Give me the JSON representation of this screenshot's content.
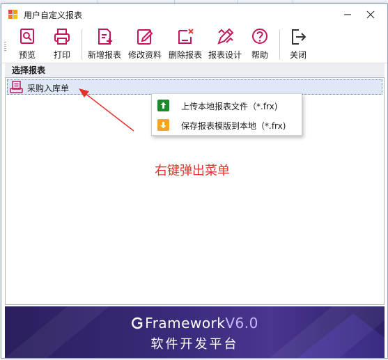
{
  "window": {
    "title": "用户自定义报表"
  },
  "toolbar": {
    "buttons": [
      {
        "label": "预览",
        "icon": "preview-icon"
      },
      {
        "label": "打印",
        "icon": "printer-icon"
      },
      {
        "label": "新增报表",
        "icon": "new-report-icon"
      },
      {
        "label": "修改资料",
        "icon": "edit-icon"
      },
      {
        "label": "删除报表",
        "icon": "delete-report-icon"
      },
      {
        "label": "报表设计",
        "icon": "design-icon"
      },
      {
        "label": "帮助",
        "icon": "help-icon"
      },
      {
        "label": "关闭",
        "icon": "exit-icon"
      }
    ]
  },
  "section": {
    "title": "选择报表"
  },
  "tree": {
    "items": [
      {
        "label": "采购入库单",
        "icon": "report-icon"
      }
    ]
  },
  "context_menu": {
    "items": [
      {
        "label": "上传本地报表文件（*.frx)",
        "icon": "upload-icon",
        "color": "#1e8a2e"
      },
      {
        "label": "保存报表模版到本地（*.frx)",
        "icon": "download-icon",
        "color": "#f2a427"
      }
    ]
  },
  "annotation": {
    "text": "右键弹出菜单",
    "color": "#e5302a"
  },
  "banner": {
    "logo_text": "Framework",
    "version": "V6.0",
    "subtitle": "软件开发平台"
  },
  "colors": {
    "accent": "#c2185b",
    "selection": "#dfe8f7"
  }
}
